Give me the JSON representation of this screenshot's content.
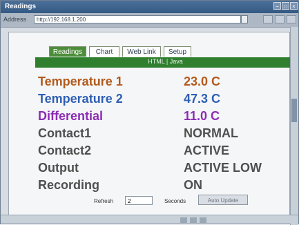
{
  "window": {
    "title": "Readings"
  },
  "address": {
    "label": "Address",
    "url": "http://192.168.1.200"
  },
  "tabs": [
    "Readings",
    "Chart",
    "Web Link",
    "Setup"
  ],
  "greenbar": {
    "label": "HTML | Java"
  },
  "readings": [
    {
      "label": "Temperature 1",
      "value": "23.0 C"
    },
    {
      "label": "Temperature 2",
      "value": "47.3 C"
    },
    {
      "label": "Differential",
      "value": "11.0 C"
    },
    {
      "label": "Contact1",
      "value": "NORMAL"
    },
    {
      "label": "Contact2",
      "value": "ACTIVE"
    },
    {
      "label": "Output",
      "value": "ACTIVE LOW"
    },
    {
      "label": "Recording",
      "value": "ON"
    }
  ],
  "refresh": {
    "label": "Refresh",
    "value": "2",
    "seconds_label": "Seconds",
    "button": "Auto Update"
  }
}
